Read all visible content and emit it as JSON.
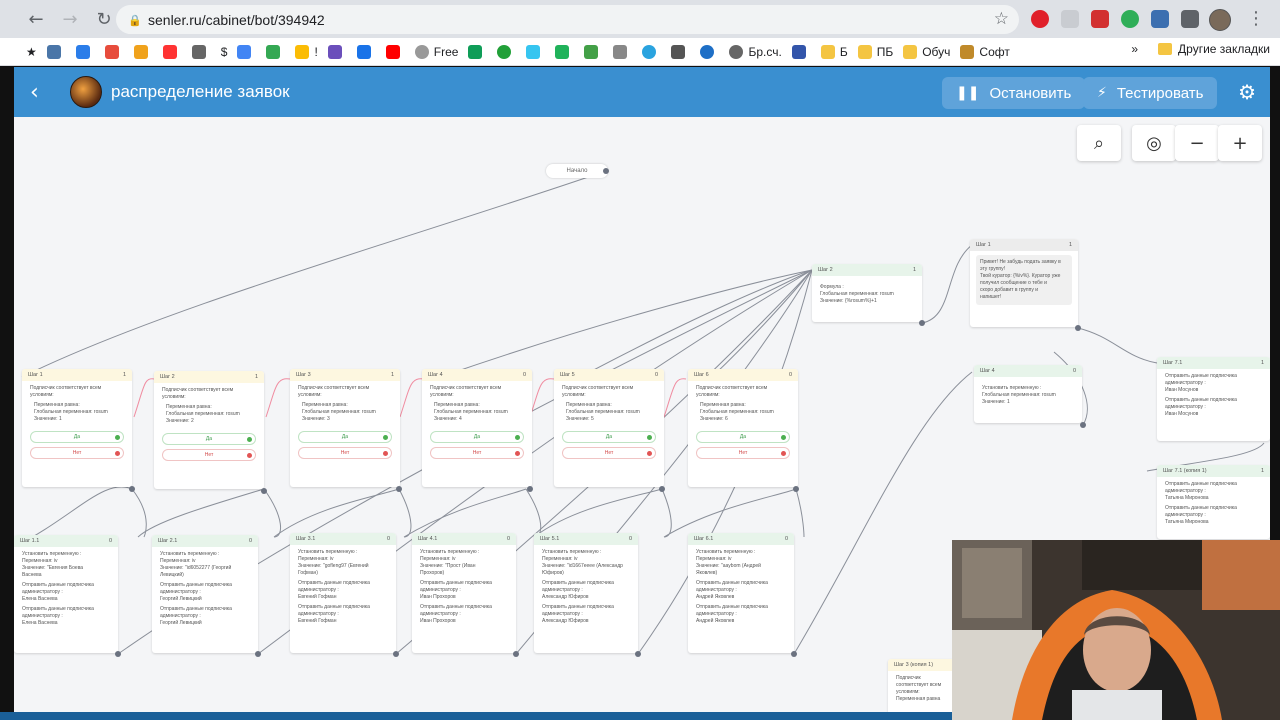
{
  "browser": {
    "url": "senler.ru/cabinet/bot/394942",
    "bookmarks": [
      "Free",
      "$",
      "Бр.сч.",
      "Б",
      "ПБ",
      "Обуч",
      "Софт"
    ],
    "other_bookmarks": "Другие закладки",
    "more_bookmarks": "»",
    "bookmark_symbols": [
      "!"
    ]
  },
  "header": {
    "title": "распределение заявок",
    "stop_label": "Остановить",
    "test_label": "Тестировать"
  },
  "canvas": {
    "start_label": "Начало",
    "zoom_controls": [
      "search-icon",
      "locate-icon",
      "zoom-out-icon",
      "zoom-in-icon"
    ]
  },
  "conditions": [
    {
      "title": "Шаг 1",
      "count": "1",
      "text": "Подписчик соответствует всем условиям:",
      "sub": [
        "Переменная равна:",
        "Глобальная переменная: rosum",
        "Значение: 1"
      ],
      "yes": "Да",
      "no": "Нет"
    },
    {
      "title": "Шаг 2",
      "count": "1",
      "text": "Подписчик соответствует всем условиям:",
      "sub": [
        "Переменная равна:",
        "Глобальная переменная: rosum",
        "Значение: 2"
      ],
      "yes": "Да",
      "no": "Нет"
    },
    {
      "title": "Шаг 3",
      "count": "1",
      "text": "Подписчик соответствует всем условиям:",
      "sub": [
        "Переменная равна:",
        "Глобальная переменная: rosum",
        "Значение: 3"
      ],
      "yes": "Да",
      "no": "Нет"
    },
    {
      "title": "Шаг 4",
      "count": "0",
      "text": "Подписчик соответствует всем условиям:",
      "sub": [
        "Переменная равна:",
        "Глобальная переменная: rosum",
        "Значение: 4"
      ],
      "yes": "Да",
      "no": "Нет"
    },
    {
      "title": "Шаг 5",
      "count": "0",
      "text": "Подписчик соответствует всем условиям:",
      "sub": [
        "Переменная равна:",
        "Глобальная переменная: rosum",
        "Значение: 5"
      ],
      "yes": "Да",
      "no": "Нет"
    },
    {
      "title": "Шаг 6",
      "count": "0",
      "text": "Подписчик соответствует всем условиям:",
      "sub": [
        "Переменная равна:",
        "Глобальная переменная: rosum",
        "Значение: 6"
      ],
      "yes": "Да",
      "no": "Нет"
    }
  ],
  "actions": [
    {
      "title": "Шаг 1.1",
      "count": "0",
      "lines": [
        "Установить переменную :",
        "Переменная: iv",
        "Значение: \"Евгения Боева",
        "Васнева",
        "Отправить данные подписчика",
        "администратору :",
        "Елена Васнева",
        "Отправить данные подписчика",
        "администратору :",
        "Елена Васнева"
      ]
    },
    {
      "title": "Шаг 2.1",
      "count": "0",
      "lines": [
        "Установить переменную :",
        "Переменная: iv",
        "Значение: \"id6052277 (Георгий",
        "Левицкий)",
        "Отправить данные подписчика",
        "администратору :",
        "Георгий Левицкий",
        "Отправить данные подписчика",
        "администратору :",
        "Георгий Левицкий"
      ]
    },
    {
      "title": "Шаг 3.1",
      "count": "0",
      "lines": [
        "Установить переменную :",
        "Переменная: iv",
        "Значение: \"gofleng97 (Евгений",
        "Гофман)",
        "Отправить данные подписчика",
        "администратору :",
        "Евгений Гофман",
        "Отправить данные подписчика",
        "администратору :",
        "Евгений Гофман"
      ]
    },
    {
      "title": "Шаг 4.1",
      "count": "0",
      "lines": [
        "Установить переменную :",
        "Переменная: iv",
        "Значение: \"Прост (Иван",
        "Прохоров)",
        "Отправить данные подписчика",
        "администратору :",
        "Иван Прохоров",
        "Отправить данные подписчика",
        "администратору :",
        "Иван Прохоров"
      ]
    },
    {
      "title": "Шаг 5.1",
      "count": "0",
      "lines": [
        "Установить переменную :",
        "Переменная: iv",
        "Значение: \"id1667eeee (Александр",
        "Юфиров)",
        "Отправить данные подписчика",
        "администратору :",
        "Александр Юфиров",
        "Отправить данные подписчика",
        "администратору :",
        "Александр Юфиров"
      ]
    },
    {
      "title": "Шаг 6.1",
      "count": "0",
      "lines": [
        "Установить переменную :",
        "Переменная: iv",
        "Значение: \"aaybom (Андрей",
        "Яковлев)",
        "Отправить данные подписчика",
        "администратору :",
        "Андрей Яковлев",
        "Отправить данные подписчика",
        "администратору :",
        "Андрей Яковлев"
      ]
    }
  ],
  "step2": {
    "title": "Шаг 2",
    "count": "1",
    "lines": [
      "Формула :",
      "Глобальная переменная: rosum",
      "Значение: {%rosum%}+1"
    ]
  },
  "step1msg": {
    "title": "Шаг 1",
    "count": "1",
    "lines": [
      "Привет! Не забудь подать заявку в",
      "эту группу!",
      "Твой куратор: {%iv%}. Куратор уже",
      "получил сообщение о тебе и",
      "скоро добавит в группу и",
      "напишет!"
    ]
  },
  "step4": {
    "title": "Шаг 4",
    "count": "0",
    "lines": [
      "Установить переменную :",
      "Глобальная переменная: rosum",
      "Значение: 1"
    ]
  },
  "step7": {
    "title": "Шаг 7.1",
    "count": "1",
    "lines": [
      "Отправить данные подписчика",
      "администратору :",
      "Иван Мосунов",
      "Отправить данные подписчика",
      "администратору :",
      "Иван Мосунов"
    ]
  },
  "step71": {
    "title": "Шаг 7.1 (копия 1)",
    "count": "1",
    "lines": [
      "Отправить данные подписчика",
      "администратору :",
      "Татьяна Миронова",
      "Отправить данные подписчика",
      "администратору :",
      "Татьяна Миронова"
    ]
  },
  "step3copy": {
    "title": "Шаг 3 (копия 1)",
    "count": "",
    "lines": [
      "Подписчик соответствует всем",
      "условиям:",
      "Переменная равна"
    ]
  }
}
